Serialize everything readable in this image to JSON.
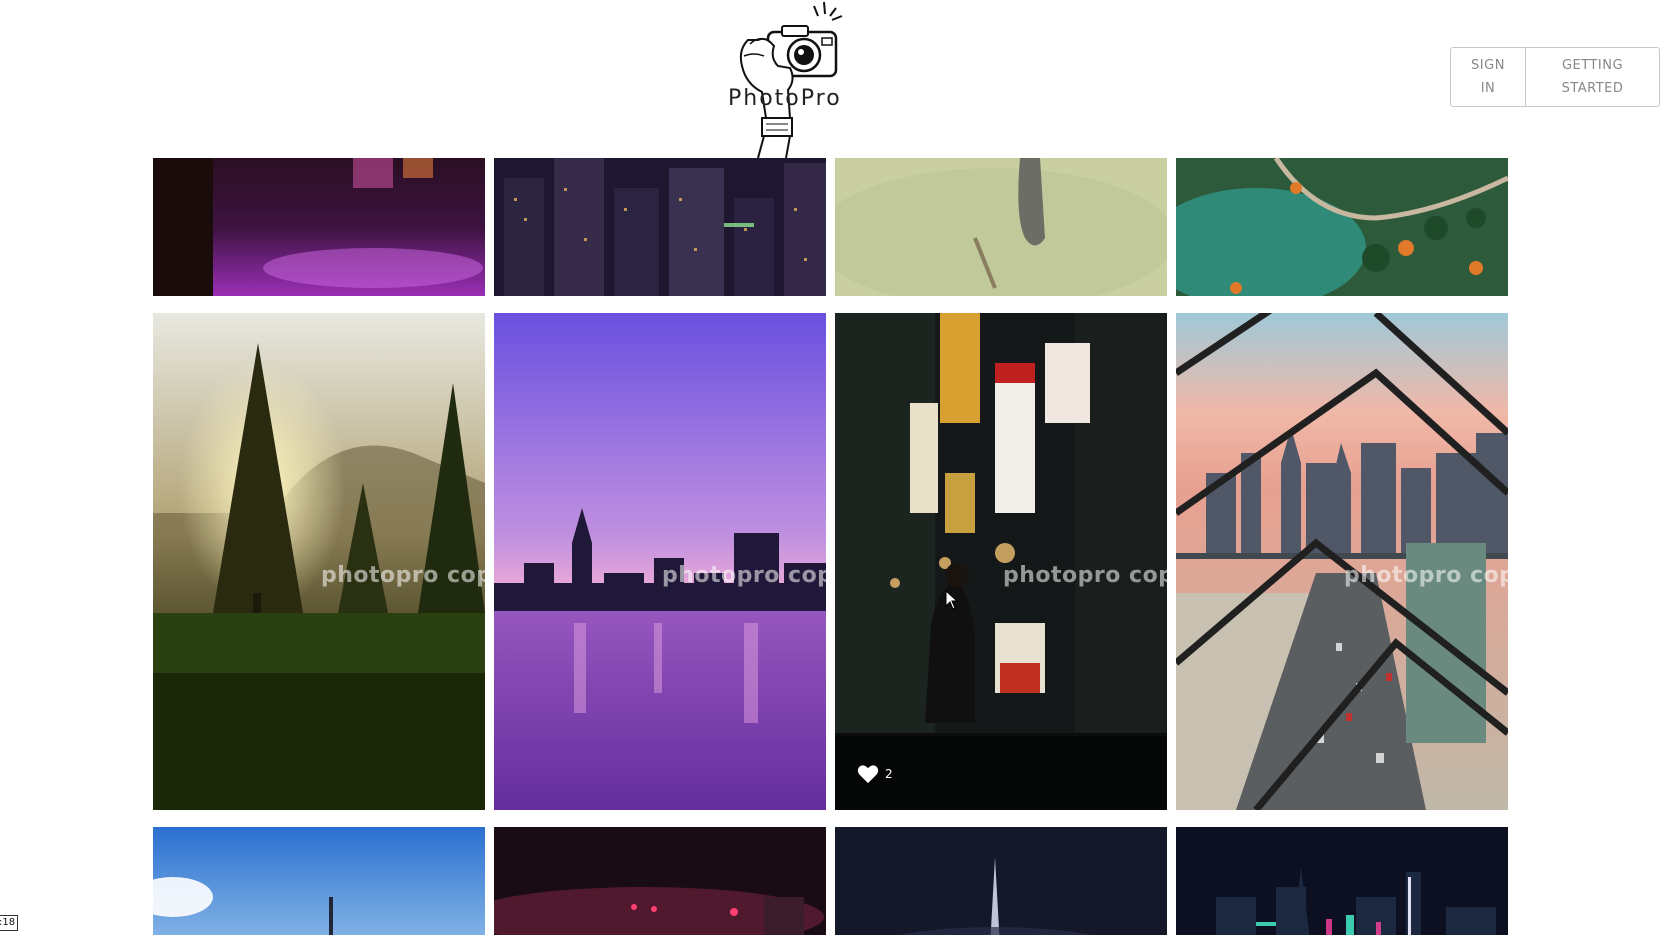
{
  "brand": {
    "name": "PhotoPro"
  },
  "auth": {
    "sign_in": "SIGN\nIN",
    "getting_started": "GETTING\nSTARTED"
  },
  "watermark": "photopro cop",
  "gallery": {
    "featured_likes": "2"
  },
  "corner_badge": ":18",
  "colors": {
    "border": "#c8c8c8",
    "button_text": "#888888",
    "overlay": "rgba(0,0,0,0.55)"
  }
}
